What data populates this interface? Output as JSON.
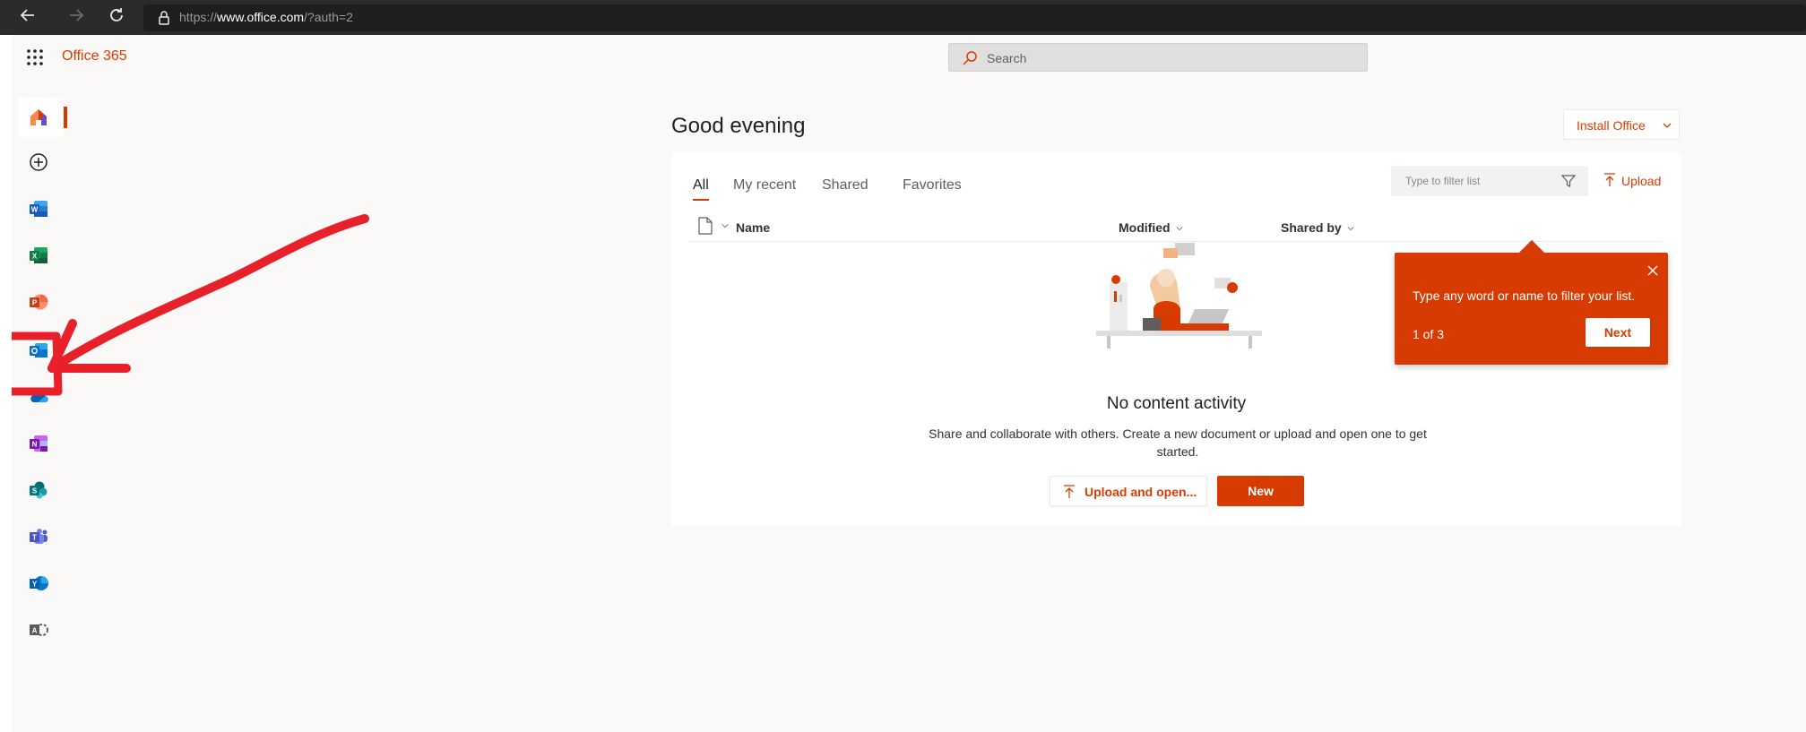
{
  "browser": {
    "url_prefix": "https://",
    "url_domain": "www.office.com",
    "url_path": "/?auth=2"
  },
  "header": {
    "app_title": "Office 365",
    "search_placeholder": "Search"
  },
  "rail": {
    "items": [
      "Home",
      "Create",
      "Word",
      "Excel",
      "PowerPoint",
      "Outlook",
      "OneDrive",
      "OneNote",
      "SharePoint",
      "Teams",
      "Yammer",
      "Admin"
    ],
    "active": "Home"
  },
  "main": {
    "greeting": "Good evening",
    "install_label": "Install Office",
    "tabs": [
      "All",
      "My recent",
      "Shared",
      "Favorites"
    ],
    "active_tab": "All",
    "filter_placeholder": "Type to filter list",
    "upload_label": "Upload",
    "columns": [
      "Name",
      "Modified",
      "Shared by"
    ],
    "empty_title": "No content activity",
    "empty_desc": "Share and collaborate with others. Create a new document or upload and open one to get started.",
    "upload_open_label": "Upload and open...",
    "new_label": "New"
  },
  "teaching_bubble": {
    "text": "Type any word or name to filter your list.",
    "step": "1 of 3",
    "next_label": "Next"
  },
  "colors": {
    "accent": "#d83b01",
    "background": "#faf9f8",
    "annotation": "#e8202a"
  },
  "icons": [
    "back-icon",
    "forward-icon",
    "refresh-icon",
    "lock-icon",
    "waffle-icon",
    "search-icon",
    "chevron-down-icon",
    "filter-icon",
    "upload-icon",
    "document-icon",
    "close-icon"
  ]
}
